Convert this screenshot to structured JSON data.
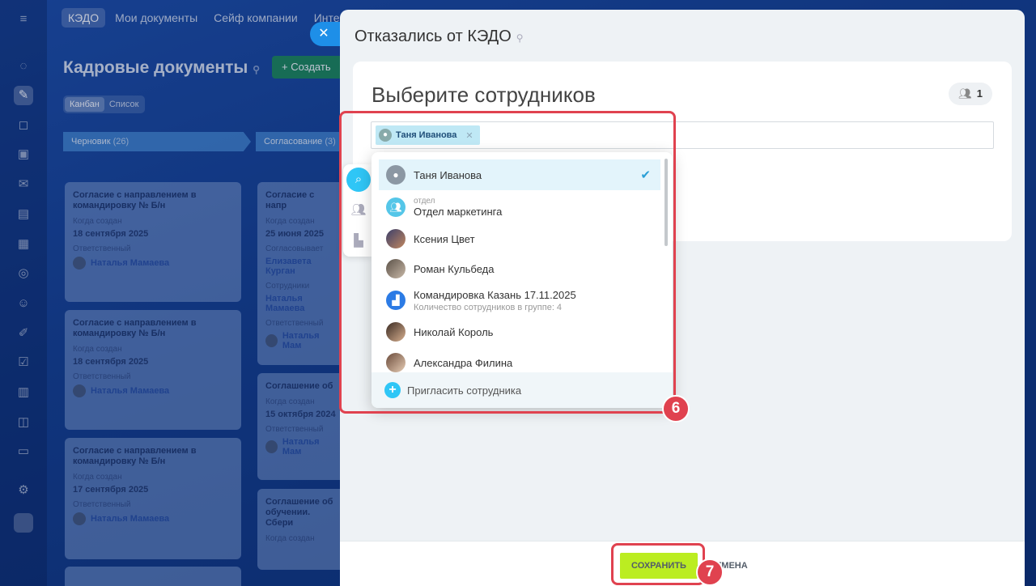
{
  "background": {
    "nav": [
      "КЭДО",
      "Мои документы",
      "Сейф компании",
      "Интегр"
    ],
    "page_title": "Кадровые документы",
    "create_button": "+ Создать",
    "views": [
      "Канбан",
      "Список"
    ],
    "columns": [
      {
        "label": "Черновик",
        "count": "(26)"
      },
      {
        "label": "Согласование",
        "count": "(3)"
      }
    ],
    "cards_col1": [
      {
        "title": "Согласие с направлением в командировку № Б/н",
        "label1": "Когда создан",
        "date": "18 сентября 2025",
        "label2": "Ответственный",
        "person": "Наталья Мамаева"
      },
      {
        "title": "Согласие с направлением в командировку № Б/н",
        "label1": "Когда создан",
        "date": "18 сентября 2025",
        "label2": "Ответственный",
        "person": "Наталья Мамаева"
      },
      {
        "title": "Согласие с направлением в командировку № Б/н",
        "label1": "Когда создан",
        "date": "17 сентября 2025",
        "label2": "Ответственный",
        "person": "Наталья Мамаева"
      }
    ],
    "cards_col2": [
      {
        "title": "Согласие с напр",
        "label1": "Когда создан",
        "date": "25 июня 2025",
        "label2": "Согласовывает",
        "person": "Елизавета Курган",
        "label3": "Сотрудники",
        "person2": "Наталья Мамаева",
        "label4": "Ответственный",
        "person3": "Наталья Мам"
      },
      {
        "title": "Соглашение об",
        "label1": "Когда создан",
        "date": "15 октября 2024",
        "label2": "Ответственный",
        "person": "Наталья Мам"
      },
      {
        "title": "Соглашение об обучении. Сбери",
        "label1": "Когда создан",
        "date": ""
      }
    ]
  },
  "slider": {
    "title": "Отказались от КЭДО",
    "heading": "Выберите сотрудников",
    "count": "1",
    "selected_tag": "Таня Иванова"
  },
  "dropdown": {
    "items": [
      {
        "name": "Таня Иванова",
        "sub": "",
        "sub2": "",
        "selected": true
      },
      {
        "name": "Отдел маркетинга",
        "sub": "отдел",
        "sub2": ""
      },
      {
        "name": "Ксения Цвет",
        "sub": "",
        "sub2": ""
      },
      {
        "name": "Роман Кульбеда",
        "sub": "",
        "sub2": ""
      },
      {
        "name": "Командировка Казань 17.11.2025",
        "sub": "",
        "sub2": "Количество сотрудников в группе: 4"
      },
      {
        "name": "Николай Король",
        "sub": "",
        "sub2": ""
      },
      {
        "name": "Александра Филина",
        "sub": "",
        "sub2": ""
      }
    ],
    "invite": "Пригласить сотрудника"
  },
  "footer": {
    "save": "СОХРАНИТЬ",
    "cancel": "ОТМЕНА"
  },
  "annotations": {
    "badge6": "6",
    "badge7": "7"
  },
  "colors": {
    "accent": "#2fc6f6",
    "save_green": "#bbed21",
    "annotation_red": "#e0424f"
  }
}
